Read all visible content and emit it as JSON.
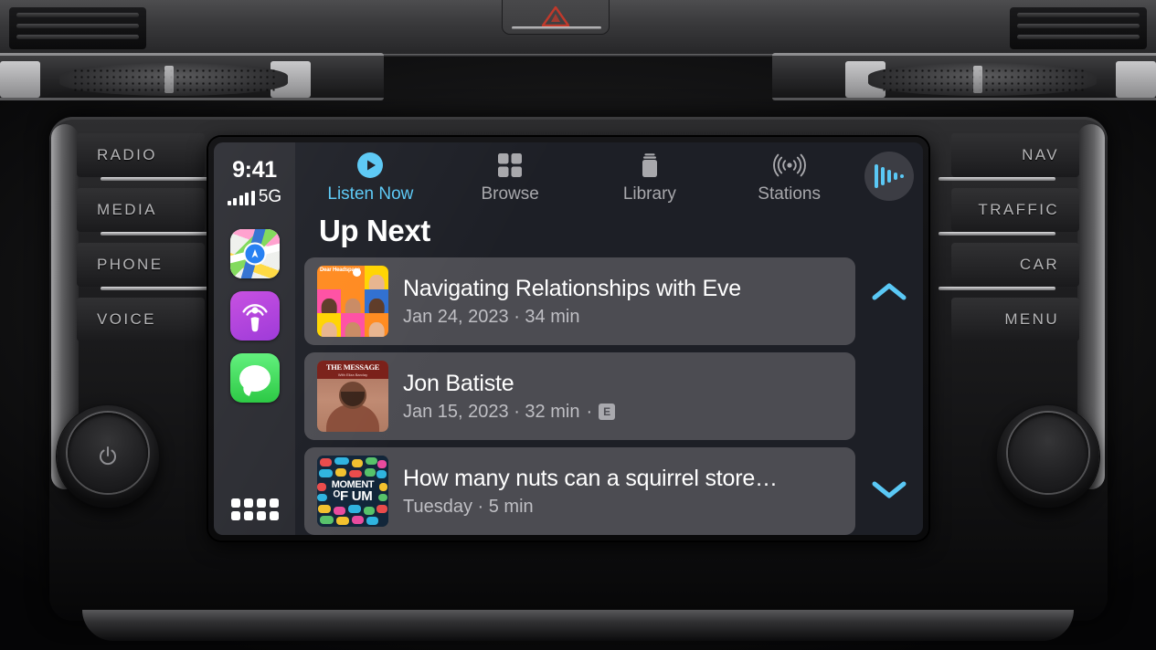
{
  "car": {
    "hazard_icon": "hazard-triangle-icon",
    "left_buttons": [
      "RADIO",
      "MEDIA",
      "PHONE",
      "VOICE"
    ],
    "right_buttons": [
      "NAV",
      "TRAFFIC",
      "CAR",
      "MENU"
    ],
    "left_knob_icon": "power-icon",
    "right_knob_icon": "tuning-knob-icon"
  },
  "screen": {
    "status": {
      "time": "9:41",
      "network": "5G",
      "signal_icon": "signal-bars-icon",
      "signal_bars": 5
    },
    "sidebar": {
      "apps": [
        {
          "name": "Maps",
          "icon": "maps-icon"
        },
        {
          "name": "Podcasts",
          "icon": "podcasts-icon"
        },
        {
          "name": "Messages",
          "icon": "messages-icon"
        }
      ],
      "grid_button": "app-grid-icon"
    },
    "nav": {
      "tabs": [
        {
          "label": "Listen Now",
          "icon": "play-circle-icon",
          "active": true
        },
        {
          "label": "Browse",
          "icon": "grid-squares-icon",
          "active": false
        },
        {
          "label": "Library",
          "icon": "library-book-icon",
          "active": false
        },
        {
          "label": "Stations",
          "icon": "broadcast-icon",
          "active": false
        }
      ],
      "now_playing_button": "now-playing-waveform-icon"
    },
    "section": {
      "title": "Up Next"
    },
    "episodes": [
      {
        "title": "Navigating Relationships with Eve",
        "subtitle": "Jan 24, 2023 · 34 min",
        "date": "Jan 24, 2023",
        "duration": "34 min",
        "explicit": false,
        "artwork": "dear-headspace-artwork",
        "artwork_text": "Dear Headspace"
      },
      {
        "title": "Jon Batiste",
        "subtitle": "Jan 15, 2023 · 32 min",
        "date": "Jan 15, 2023",
        "duration": "32 min",
        "explicit": true,
        "explicit_badge": "E",
        "artwork": "the-message-artwork",
        "artwork_text": "THE MESSAGE",
        "artwork_subtext": "With Eliza Barclay"
      },
      {
        "title": "How many nuts can a squirrel store…",
        "subtitle": "Tuesday · 5 min",
        "date": "Tuesday",
        "duration": "5 min",
        "explicit": false,
        "artwork": "moment-of-um-artwork",
        "artwork_text_1": "MOMENT",
        "artwork_text_2": "ᴼF UM"
      }
    ],
    "scroll": {
      "up_icon": "chevron-up-icon",
      "down_icon": "chevron-down-icon"
    },
    "colors": {
      "accent": "#5ac8f5",
      "background": "#1d1f26",
      "sidebar": "#2a2b31",
      "row": "#4c4c52",
      "title_text": "#ffffff",
      "subtitle_text": "#bfbfc4",
      "inactive_tab": "#a8a8ac"
    }
  }
}
